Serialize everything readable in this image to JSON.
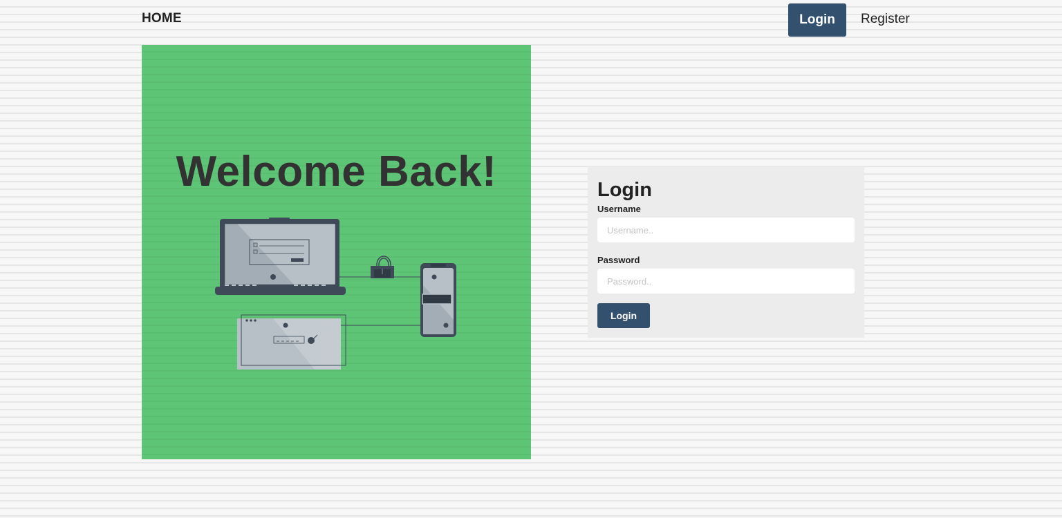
{
  "nav": {
    "home_label": "HOME",
    "login_label": "Login",
    "register_label": "Register"
  },
  "hero": {
    "title": "Welcome Back!",
    "illustration_icon": "devices-security-illustration",
    "background_color": "#5ec576"
  },
  "login_form": {
    "title": "Login",
    "username_label": "Username",
    "username_placeholder": "Username..",
    "username_value": "",
    "password_label": "Password",
    "password_placeholder": "Password..",
    "password_value": "",
    "submit_label": "Login"
  },
  "colors": {
    "accent": "#34506f",
    "card_background": "#ececec",
    "page_background": "#f6f6f6"
  }
}
